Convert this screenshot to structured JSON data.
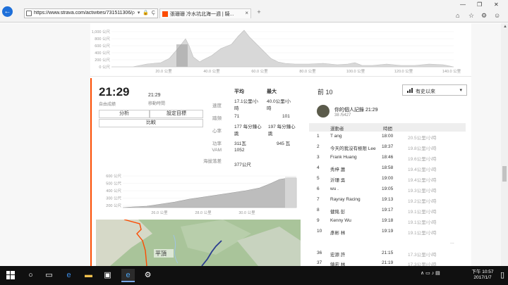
{
  "browser": {
    "url": "https://www.strava.com/activities/731511306/",
    "tab_title": "張珊珊 冷水坑北海一週 | 騎...",
    "addr_icons": "ρ ▾ 🔒 Ç",
    "new_tab": "+",
    "tab_close": "×",
    "win_controls": [
      "—",
      "❐",
      "✕"
    ],
    "tools": [
      "⌂",
      "☆",
      "⚙",
      "☺"
    ]
  },
  "top_chart": {
    "y_ticks": [
      "1,000 公尺",
      "800 公尺",
      "600 公尺",
      "400 公尺",
      "200 公尺",
      "0 公尺"
    ],
    "x_ticks": [
      "20.0 公里",
      "40.0 公里",
      "60.0 公里",
      "80.0 公里",
      "100.0 公里",
      "120.0 公里",
      "140.0 公里"
    ]
  },
  "summary": {
    "moving_time": "21:29",
    "moving_time_label": "自由成績",
    "elapsed_time": "21:29",
    "elapsed_label": "移動時間",
    "btn_analysis": "分析",
    "btn_goal": "設定目標",
    "btn_compare": "比較"
  },
  "stats": {
    "col_avg": "平均",
    "col_max": "最大",
    "rows": [
      {
        "label": "速度",
        "avg": "17.1公里/小時",
        "max": "40.0公里/小時"
      },
      {
        "label": "踏頻",
        "avg": "71",
        "max": "101"
      },
      {
        "label": "心率",
        "avg": "177 每分鐘心跳",
        "max": "197 每分鐘心跳"
      },
      {
        "label": "功率",
        "avg": "311瓦",
        "max": "945 瓦"
      },
      {
        "label": "VAM",
        "avg": "1052",
        "max": ""
      },
      {
        "label": "海拔落差",
        "avg": "377公尺",
        "max": ""
      }
    ]
  },
  "mid_chart": {
    "y_ticks": [
      "600 公尺",
      "500 公尺",
      "400 公尺",
      "300 公尺",
      "200 公尺"
    ],
    "x_ticks": [
      "26.0 公里",
      "28.0 公里",
      "30.0 公里"
    ]
  },
  "map": {
    "place_label": "平頂"
  },
  "leaderboard": {
    "title": "前 10",
    "filter_label": "有史以來",
    "pr_title": "你的個人記錄 21:29",
    "pr_sub": "38 /5427",
    "col_athlete": "運動者",
    "col_time": "時間",
    "rows": [
      {
        "rank": "1",
        "name": "T ang",
        "time": "18:00",
        "speed": "20.5公里/小時"
      },
      {
        "rank": "2",
        "name": "今天的我沒有極限 Lee",
        "time": "18:37",
        "speed": "19.8公里/小時"
      },
      {
        "rank": "3",
        "name": "Frank Huang",
        "time": "18:46",
        "speed": "19.6公里/小時"
      },
      {
        "rank": "4",
        "name": "秀梓 蕭",
        "time": "18:58",
        "speed": "19.4公里/小時"
      },
      {
        "rank": "5",
        "name": "沂珊 吳",
        "time": "19:00",
        "speed": "19.4公里/小時"
      },
      {
        "rank": "6",
        "name": "wu .",
        "time": "19:05",
        "speed": "19.3公里/小時"
      },
      {
        "rank": "7",
        "name": "Rayray Racing",
        "time": "19:13",
        "speed": "19.2公里/小時"
      },
      {
        "rank": "8",
        "name": "健銘 彭",
        "time": "19:17",
        "speed": "19.1公里/小時"
      },
      {
        "rank": "9",
        "name": "Kenny Wu",
        "time": "19:18",
        "speed": "19.1公里/小時"
      },
      {
        "rank": "10",
        "name": "彥彬 林",
        "time": "19:19",
        "speed": "19.1公里/小時"
      }
    ],
    "ellipsis": "...",
    "extra_rows": [
      {
        "rank": "36",
        "name": "宏源 許",
        "time": "21:15",
        "speed": "17.3公里/小時"
      },
      {
        "rank": "37",
        "name": "鎮宏 林",
        "time": "21:19",
        "speed": "17.3公里/小時"
      }
    ]
  },
  "taskbar": {
    "clock_time": "下午 10:57",
    "clock_date": "2017/1/7",
    "tray": "∧ ▭ ♪ ▤"
  },
  "colors": {
    "strava_orange": "#fc4c02",
    "ie_blue": "#1e6fd9",
    "taskbar": "#101010"
  }
}
